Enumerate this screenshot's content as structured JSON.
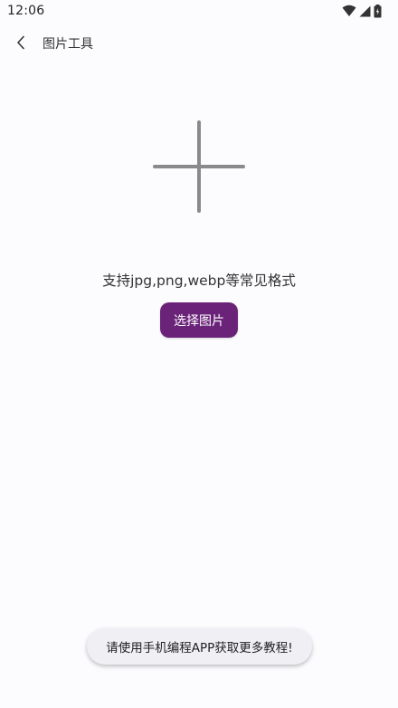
{
  "status_bar": {
    "time": "12:06",
    "icons": [
      "wifi-icon",
      "cell-signal-icon",
      "battery-icon"
    ]
  },
  "app_bar": {
    "back_icon": "chevron-left-icon",
    "title": "图片工具"
  },
  "main": {
    "add_icon": "plus-icon",
    "hint": "支持jpg,png,webp等常见格式",
    "select_button_label": "选择图片"
  },
  "toast": {
    "message": "请使用手机编程APP获取更多教程!"
  },
  "colors": {
    "accent": "#6a2378",
    "background": "#fcfbfd",
    "plus_icon": "#8a8a8a",
    "toast_bg": "#f0eff4"
  }
}
